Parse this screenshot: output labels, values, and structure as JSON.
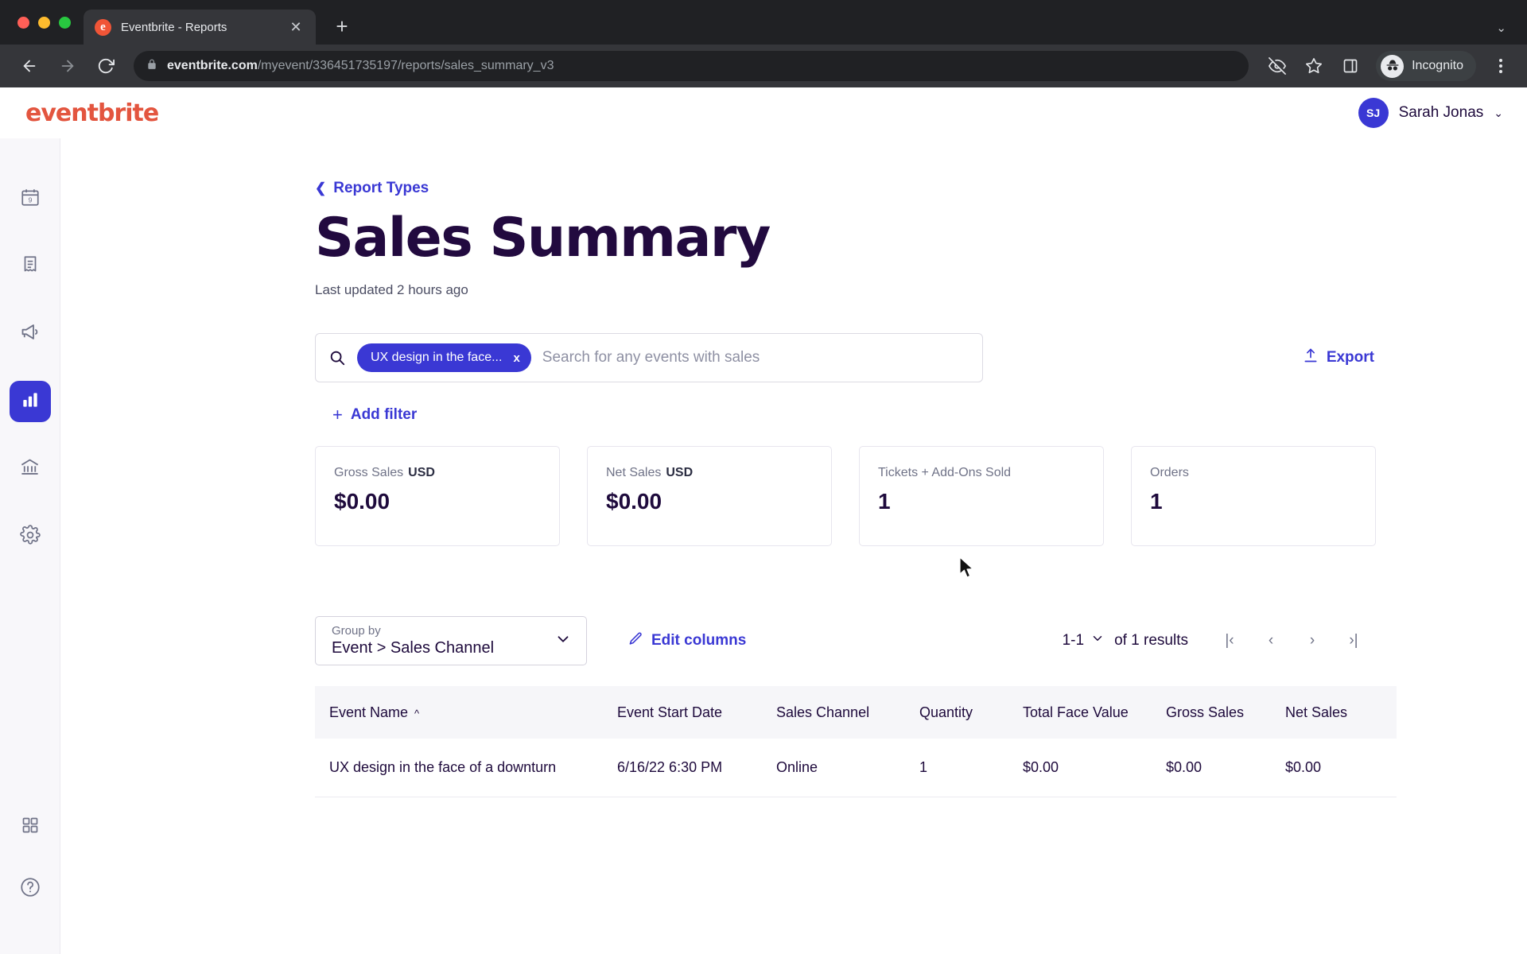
{
  "browser": {
    "tab": {
      "title": "Eventbrite - Reports",
      "favicon_letter": "e",
      "close_icon": "close-icon"
    },
    "new_tab_label": "+",
    "tab_list_chevron": "⌄",
    "url": {
      "host": "eventbrite.com",
      "path": "/myevent/336451735197/reports/sales_summary_v3"
    },
    "profile_label": "Incognito"
  },
  "topnav": {
    "logo": "eventbrite",
    "user": {
      "initials": "SJ",
      "name": "Sarah Jonas",
      "chevron": "⌄"
    }
  },
  "sidebar": {
    "items": [
      {
        "name": "calendar-icon",
        "label": "Events"
      },
      {
        "name": "receipt-icon",
        "label": "Orders"
      },
      {
        "name": "megaphone-icon",
        "label": "Marketing"
      },
      {
        "name": "bar-chart-icon",
        "label": "Reports",
        "active": true
      },
      {
        "name": "bank-icon",
        "label": "Finance"
      },
      {
        "name": "gear-icon",
        "label": "Settings"
      }
    ],
    "bottom_items": [
      {
        "name": "apps-grid-icon",
        "label": "Apps"
      },
      {
        "name": "help-circle-icon",
        "label": "Help"
      }
    ]
  },
  "page": {
    "back_link": "Report Types",
    "title": "Sales Summary",
    "last_updated": "Last updated 2 hours ago"
  },
  "search": {
    "chip_label": "UX design in the face...",
    "chip_remove": "x",
    "placeholder": "Search for any events with sales",
    "export_label": "Export",
    "add_filter_label": "Add filter",
    "add_filter_plus": "+"
  },
  "stats": [
    {
      "label": "Gross Sales",
      "currency": "USD",
      "value": "$0.00"
    },
    {
      "label": "Net Sales",
      "currency": "USD",
      "value": "$0.00"
    },
    {
      "label": "Tickets + Add-Ons Sold",
      "currency": "",
      "value": "1"
    },
    {
      "label": "Orders",
      "currency": "",
      "value": "1"
    }
  ],
  "table_controls": {
    "group_by_label": "Group by",
    "group_by_value": "Event > Sales Channel",
    "edit_columns_label": "Edit columns",
    "pagination": {
      "range": "1-1",
      "range_chevron": "⌄",
      "of_results": "of 1 results",
      "first_label": "|‹",
      "prev_label": "‹",
      "next_label": "›",
      "last_label": "›|"
    }
  },
  "table": {
    "columns": [
      {
        "label": "Event Name",
        "sort": "^"
      },
      {
        "label": "Event Start Date",
        "sort": ""
      },
      {
        "label": "Sales Channel",
        "sort": ""
      },
      {
        "label": "Quantity",
        "sort": ""
      },
      {
        "label": "Total Face Value",
        "sort": ""
      },
      {
        "label": "Gross Sales",
        "sort": ""
      },
      {
        "label": "Net Sales",
        "sort": ""
      }
    ],
    "rows": [
      {
        "event_name": "UX design in the face of a downturn",
        "event_start_date": "6/16/22 6:30 PM",
        "sales_channel": "Online",
        "quantity": "1",
        "total_face_value": "$0.00",
        "gross_sales": "$0.00",
        "net_sales": "$0.00"
      }
    ]
  },
  "colors": {
    "brand_red": "#e3553f",
    "accent_blue": "#3a38d4",
    "title_purple": "#220a3f"
  }
}
